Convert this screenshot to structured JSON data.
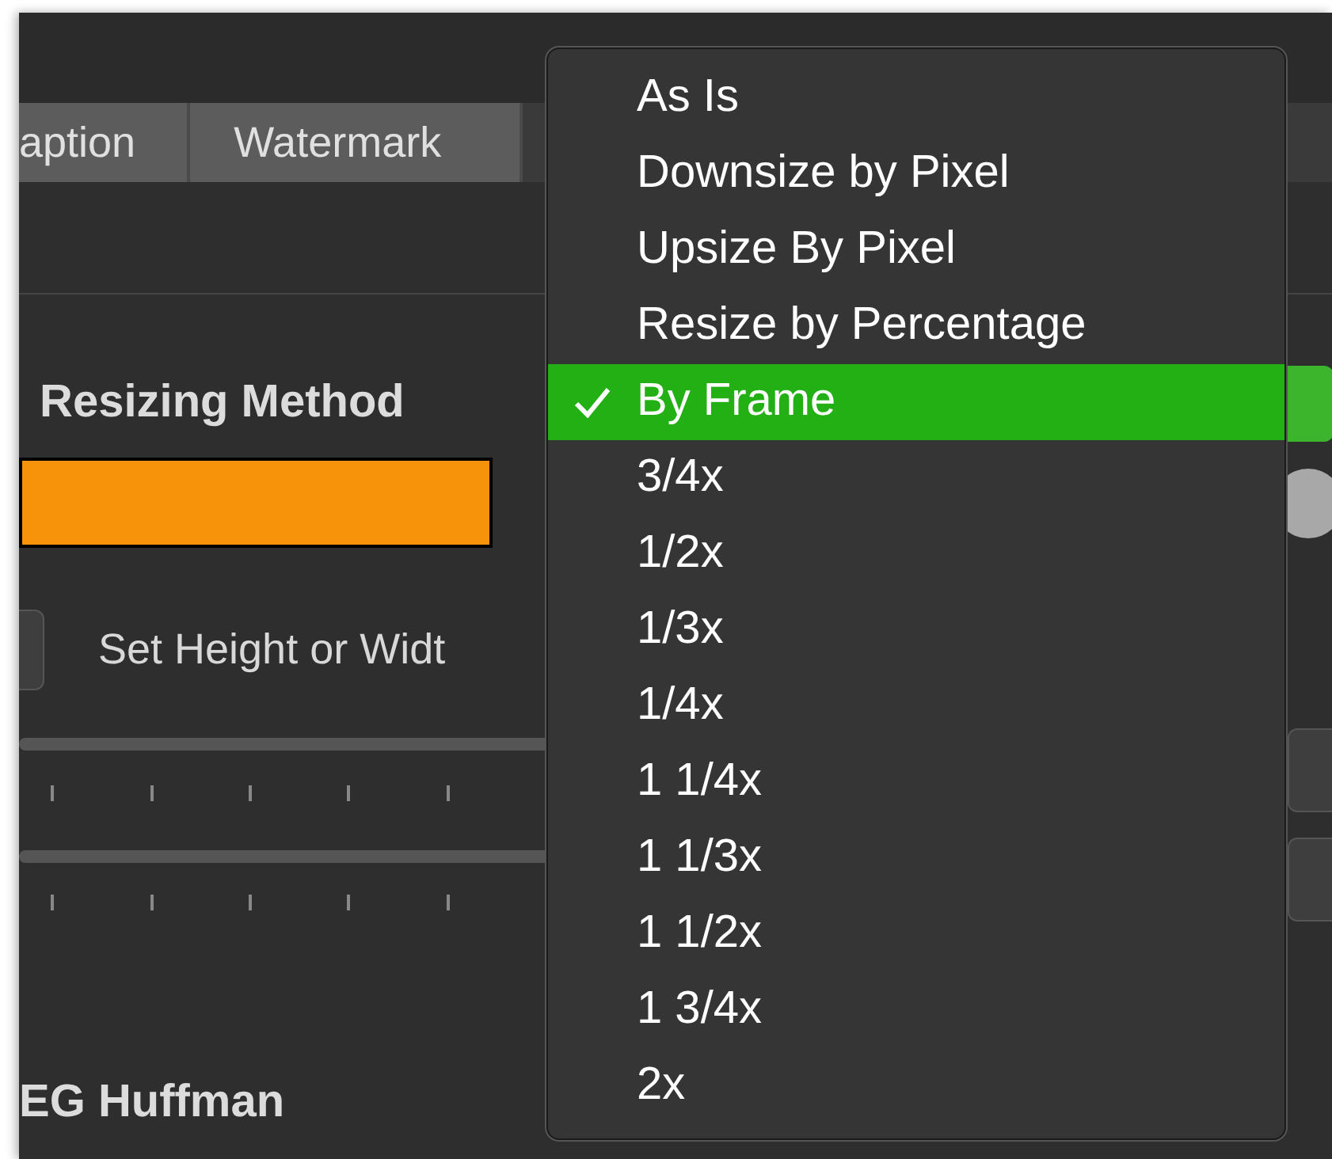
{
  "tabs": [
    {
      "label": "aption",
      "selected": false
    },
    {
      "label": "Watermark",
      "selected": false
    }
  ],
  "resizing_method": {
    "label": "Resizing Method"
  },
  "size_option": {
    "label": "Set Height or Widt"
  },
  "jpeg_section": {
    "label": "EG Huffman"
  },
  "resize_menu": {
    "items": [
      {
        "label": "As Is",
        "selected": false
      },
      {
        "label": "Downsize by Pixel",
        "selected": false
      },
      {
        "label": "Upsize By Pixel",
        "selected": false
      },
      {
        "label": "Resize by Percentage",
        "selected": false
      },
      {
        "label": "By Frame",
        "selected": true
      },
      {
        "label": "3/4x",
        "selected": false
      },
      {
        "label": "1/2x",
        "selected": false
      },
      {
        "label": "1/3x",
        "selected": false
      },
      {
        "label": "1/4x",
        "selected": false
      },
      {
        "label": "1 1/4x",
        "selected": false
      },
      {
        "label": "1 1/3x",
        "selected": false
      },
      {
        "label": "1 1/2x",
        "selected": false
      },
      {
        "label": "1 3/4x",
        "selected": false
      },
      {
        "label": "2x",
        "selected": false
      }
    ]
  }
}
